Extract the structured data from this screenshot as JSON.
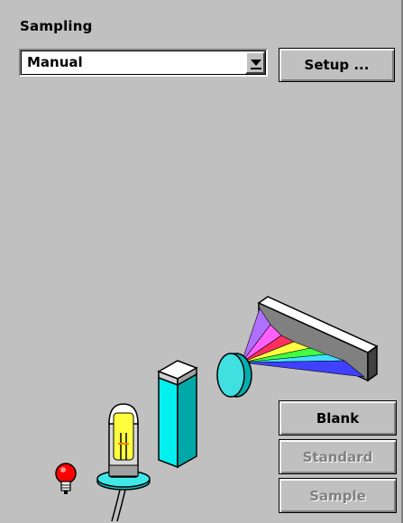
{
  "sampling": {
    "label": "Sampling",
    "selected": "Manual",
    "setup_label": "Setup ..."
  },
  "actions": {
    "blank_label": "Blank",
    "standard_label": "Standard",
    "sample_label": "Sample"
  },
  "colors": {
    "background": "#c0c0c0",
    "cuvette": "#00e0e0",
    "lamp_red": "#ff0000",
    "lamp_yellow": "#ffff40"
  }
}
